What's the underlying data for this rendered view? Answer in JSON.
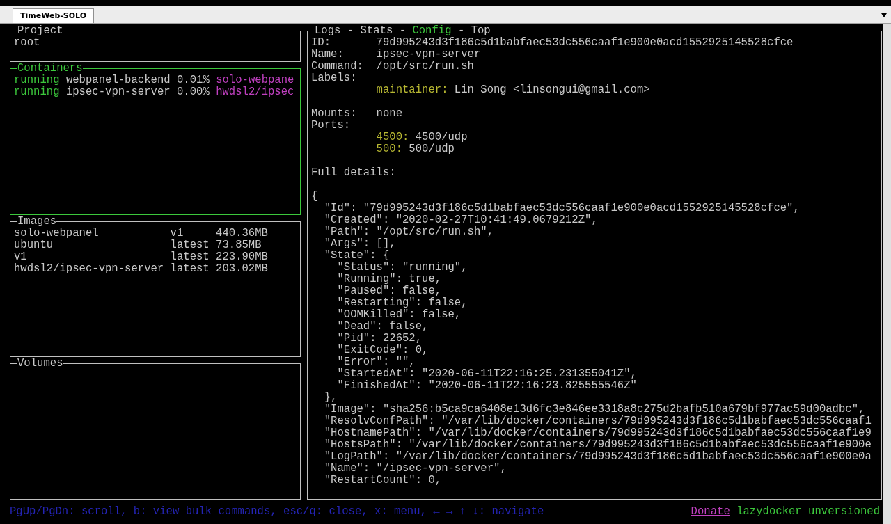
{
  "window": {
    "tab": {
      "label": "TimeWeb-SOLO",
      "selected": true
    }
  },
  "project": {
    "title": "Project",
    "focused": false,
    "items": [
      "root"
    ]
  },
  "containers": {
    "title": "Containers",
    "focused": true,
    "rows": [
      {
        "status": "running",
        "name": "webpanel-backend",
        "cpu": "0.01%",
        "image": "solo-webpane"
      },
      {
        "status": "running",
        "name": "ipsec-vpn-server",
        "cpu": "0.00%",
        "image": "hwdsl2/ipsec"
      }
    ]
  },
  "images": {
    "title": "Images",
    "focused": false,
    "rows": [
      {
        "name": "solo-webpanel",
        "tag": "v1",
        "size": "440.36MB"
      },
      {
        "name": "ubuntu",
        "tag": "latest",
        "size": "73.85MB"
      },
      {
        "name": "v1",
        "tag": "latest",
        "size": "223.90MB"
      },
      {
        "name": "hwdsl2/ipsec-vpn-server",
        "tag": "latest",
        "size": "203.02MB"
      }
    ]
  },
  "volumes": {
    "title": "Volumes",
    "focused": false
  },
  "detail": {
    "focused": false,
    "separator": "-",
    "tabs": [
      {
        "label": "Logs",
        "selected": false
      },
      {
        "label": "Stats",
        "selected": false
      },
      {
        "label": "Config",
        "selected": true
      },
      {
        "label": "Top",
        "selected": false
      }
    ],
    "lines": [
      {
        "kind": "field",
        "label": "ID:",
        "value": "79d995243d3f186c5d1babfaec53dc556caaf1e900e0acd1552925145528cfce"
      },
      {
        "kind": "field",
        "label": "Name:",
        "value": "ipsec-vpn-server"
      },
      {
        "kind": "field",
        "label": "Command:",
        "value": "/opt/src/run.sh"
      },
      {
        "kind": "field",
        "label": "Labels:"
      },
      {
        "kind": "sub",
        "label": "maintainer:",
        "value": "Lin Song <linsongui@gmail.com>"
      },
      {
        "kind": "blank"
      },
      {
        "kind": "field",
        "label": "Mounts:",
        "value": "none"
      },
      {
        "kind": "field",
        "label": "Ports:"
      },
      {
        "kind": "sub",
        "label": "4500:",
        "value": "4500/udp"
      },
      {
        "kind": "sub",
        "label": "500:",
        "value": "500/udp"
      },
      {
        "kind": "blank"
      },
      {
        "kind": "text",
        "value": "Full details:"
      },
      {
        "kind": "blank"
      },
      {
        "kind": "code",
        "value": "{"
      },
      {
        "kind": "code",
        "value": "  \"Id\": \"79d995243d3f186c5d1babfaec53dc556caaf1e900e0acd1552925145528cfce\","
      },
      {
        "kind": "code",
        "value": "  \"Created\": \"2020-02-27T10:41:49.0679212Z\","
      },
      {
        "kind": "code",
        "value": "  \"Path\": \"/opt/src/run.sh\","
      },
      {
        "kind": "code",
        "value": "  \"Args\": [],"
      },
      {
        "kind": "code",
        "value": "  \"State\": {"
      },
      {
        "kind": "code",
        "value": "    \"Status\": \"running\","
      },
      {
        "kind": "code",
        "value": "    \"Running\": true,"
      },
      {
        "kind": "code",
        "value": "    \"Paused\": false,"
      },
      {
        "kind": "code",
        "value": "    \"Restarting\": false,"
      },
      {
        "kind": "code",
        "value": "    \"OOMKilled\": false,"
      },
      {
        "kind": "code",
        "value": "    \"Dead\": false,"
      },
      {
        "kind": "code",
        "value": "    \"Pid\": 22652,"
      },
      {
        "kind": "code",
        "value": "    \"ExitCode\": 0,"
      },
      {
        "kind": "code",
        "value": "    \"Error\": \"\","
      },
      {
        "kind": "code",
        "value": "    \"StartedAt\": \"2020-06-11T22:16:25.231355041Z\","
      },
      {
        "kind": "code",
        "value": "    \"FinishedAt\": \"2020-06-11T22:16:23.825555546Z\""
      },
      {
        "kind": "code",
        "value": "  },"
      },
      {
        "kind": "code",
        "value": "  \"Image\": \"sha256:b5ca9ca6408e13d6fc3e846ee3318a8c275d2bafb510a679bf977ac59d00adbc\","
      },
      {
        "kind": "code",
        "value": "  \"ResolvConfPath\": \"/var/lib/docker/containers/79d995243d3f186c5d1babfaec53dc556caaf1"
      },
      {
        "kind": "code",
        "value": "  \"HostnamePath\": \"/var/lib/docker/containers/79d995243d3f186c5d1babfaec53dc556caaf1e9"
      },
      {
        "kind": "code",
        "value": "  \"HostsPath\": \"/var/lib/docker/containers/79d995243d3f186c5d1babfaec53dc556caaf1e900e"
      },
      {
        "kind": "code",
        "value": "  \"LogPath\": \"/var/lib/docker/containers/79d995243d3f186c5d1babfaec53dc556caaf1e900e0a"
      },
      {
        "kind": "code",
        "value": "  \"Name\": \"/ipsec-vpn-server\","
      },
      {
        "kind": "code",
        "value": "  \"RestartCount\": 0,"
      }
    ]
  },
  "status_bar": {
    "help": "PgUp/PgDn: scroll, b: view bulk commands, esc/q: close, x: menu, ← → ↑ ↓: navigate",
    "link": "Donate",
    "version": "lazydocker unversioned"
  }
}
